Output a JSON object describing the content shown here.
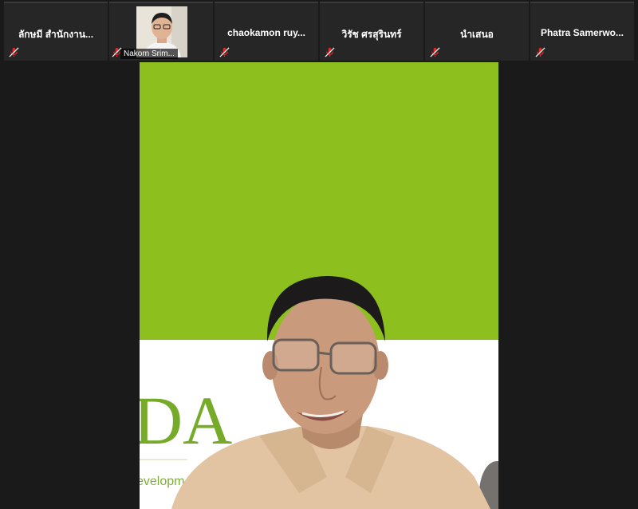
{
  "participants": [
    {
      "name": "ลักษมี สำนักงาน...",
      "has_video": false,
      "muted": true
    },
    {
      "name": "Nakorn Srim...",
      "has_video": true,
      "muted": true
    },
    {
      "name": "chaokamon ruy...",
      "has_video": false,
      "muted": true
    },
    {
      "name": "วิรัช ศรสุรินทร์",
      "has_video": false,
      "muted": true
    },
    {
      "name": "นำเสนอ",
      "has_video": false,
      "muted": true
    },
    {
      "name": "Phatra Samerwo...",
      "has_video": false,
      "muted": true
    }
  ],
  "active_speaker": {
    "background_text_large": "DA",
    "background_text_small": "evelopm"
  },
  "colors": {
    "window_bg": "#1a1a1a",
    "tile_bg": "#262626",
    "green_backdrop": "#8dbf1f",
    "mute_icon": "#e02828"
  }
}
